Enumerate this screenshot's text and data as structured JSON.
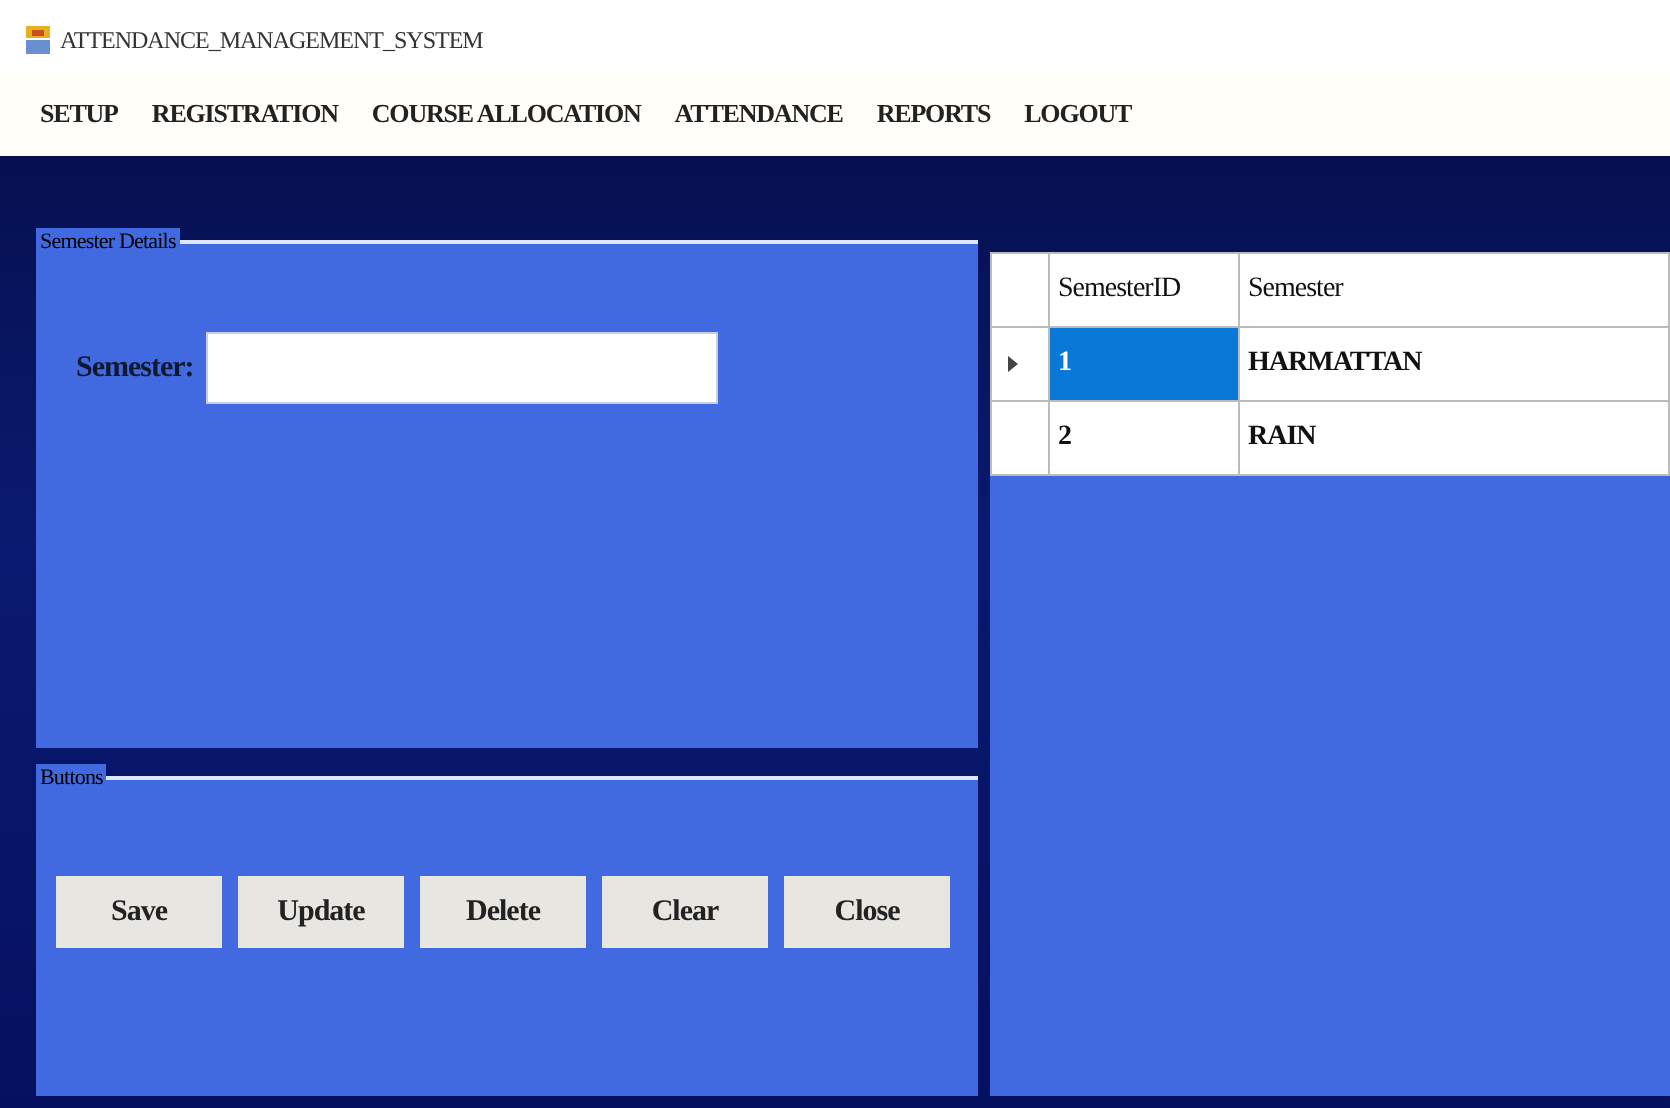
{
  "window": {
    "title": "ATTENDANCE_MANAGEMENT_SYSTEM"
  },
  "menu": [
    "SETUP",
    "REGISTRATION",
    "COURSE ALLOCATION",
    "ATTENDANCE",
    "REPORTS",
    "LOGOUT"
  ],
  "details": {
    "legend": "Semester Details",
    "label": "Semester:"
  },
  "buttons_group": {
    "legend": "Buttons",
    "buttons": [
      "Save",
      "Update",
      "Delete",
      "Clear",
      "Close"
    ]
  },
  "table": {
    "columns": [
      "SemesterID",
      "Semester"
    ],
    "rows": [
      {
        "cells": [
          "1",
          "HARMATTAN"
        ],
        "selected": true
      },
      {
        "cells": [
          "2",
          "RAIN"
        ],
        "selected": false
      }
    ]
  }
}
